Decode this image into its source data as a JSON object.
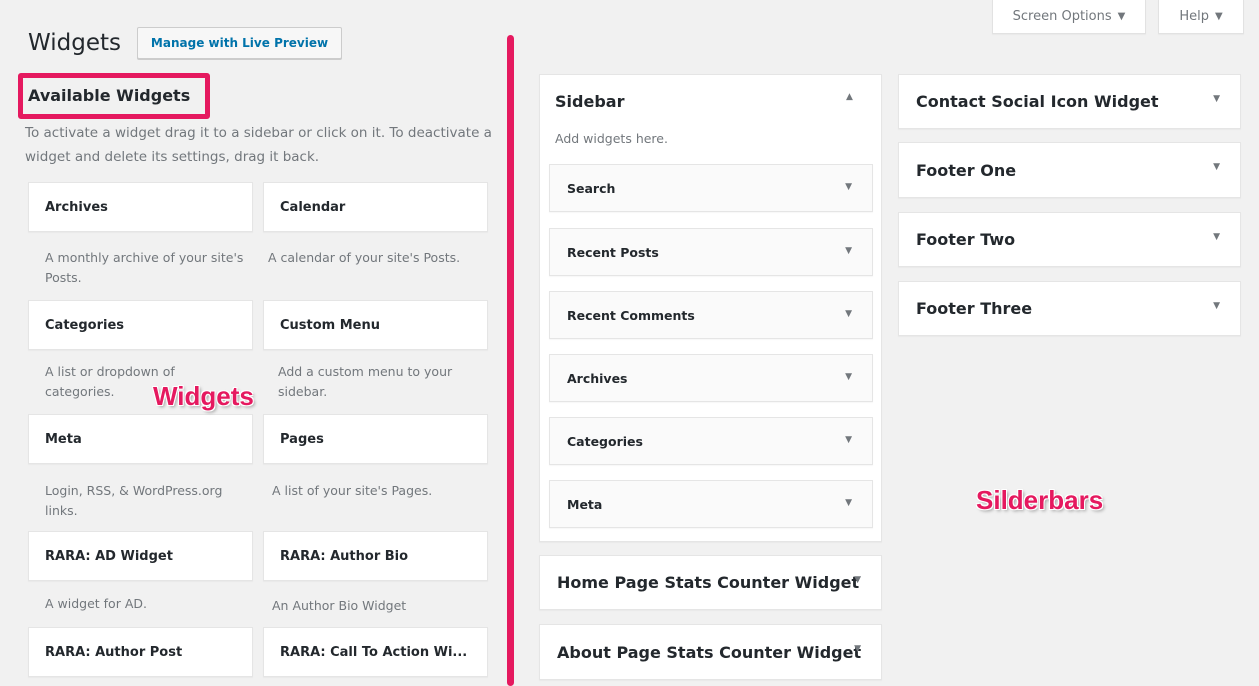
{
  "header": {
    "title": "Widgets",
    "live_preview": "Manage with Live Preview",
    "screen_options": "Screen Options",
    "help": "Help"
  },
  "available": {
    "title": "Available Widgets",
    "description": "To activate a widget drag it to a sidebar or click on it. To deactivate a widget and delete its settings, drag it back."
  },
  "widgets": [
    {
      "name": "Archives",
      "desc": "A monthly archive of your site's Posts."
    },
    {
      "name": "Calendar",
      "desc": "A calendar of your site's Posts."
    },
    {
      "name": "Categories",
      "desc": "A list or dropdown of categories."
    },
    {
      "name": "Custom Menu",
      "desc": "Add a custom menu to your sidebar."
    },
    {
      "name": "Meta",
      "desc": "Login, RSS, & WordPress.org links."
    },
    {
      "name": "Pages",
      "desc": "A list of your site's Pages."
    },
    {
      "name": "RARA: AD Widget",
      "desc": "A widget for AD."
    },
    {
      "name": "RARA: Author Bio",
      "desc": "An Author Bio Widget"
    },
    {
      "name": "RARA: Author Post",
      "desc": ""
    },
    {
      "name": "RARA: Call To Action Wi...",
      "desc": ""
    }
  ],
  "sidebar": {
    "title": "Sidebar",
    "description": "Add widgets here.",
    "items": [
      "Search",
      "Recent Posts",
      "Recent Comments",
      "Archives",
      "Categories",
      "Meta"
    ]
  },
  "sidebars_col2": [
    "Home Page Stats Counter Widget",
    "About Page Stats Counter Widget"
  ],
  "sidebars_col3": [
    "Contact Social Icon Widget",
    "Footer One",
    "Footer Two",
    "Footer Three"
  ],
  "annotations": {
    "widgets_label": "Widgets",
    "sidebars_label": "Silderbars"
  },
  "colors": {
    "accent": "#e5195f",
    "link": "#0073aa"
  },
  "icons": {
    "caret_down": "▼",
    "caret_up": "▲"
  }
}
